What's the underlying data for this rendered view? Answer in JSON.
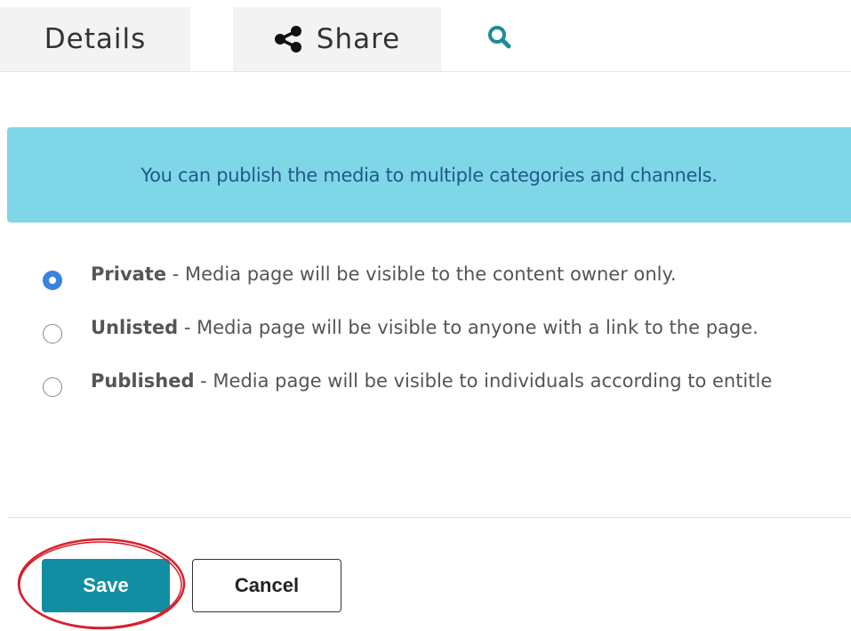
{
  "tabs": [
    {
      "label": "Details",
      "icon": ""
    },
    {
      "label": "Share",
      "icon": "share-icon"
    },
    {
      "label": "",
      "icon": "search-icon"
    }
  ],
  "colors": {
    "accent": "#128ea3",
    "banner_bg": "#7fd6e7",
    "banner_text": "#1f5a88",
    "radio_checked": "#3b82e0",
    "highlight": "#d9202a"
  },
  "banner": {
    "text": "You can publish the media to multiple categories and channels."
  },
  "options": [
    {
      "name": "Private",
      "description": " - Media page will be visible to the content owner only.",
      "checked": true
    },
    {
      "name": "Unlisted",
      "description": " - Media page will be visible to anyone with a link to the page.",
      "checked": false
    },
    {
      "name": "Published",
      "description": " - Media page will be visible to individuals according to entitle",
      "checked": false
    }
  ],
  "actions": {
    "save_label": "Save",
    "cancel_label": "Cancel"
  }
}
